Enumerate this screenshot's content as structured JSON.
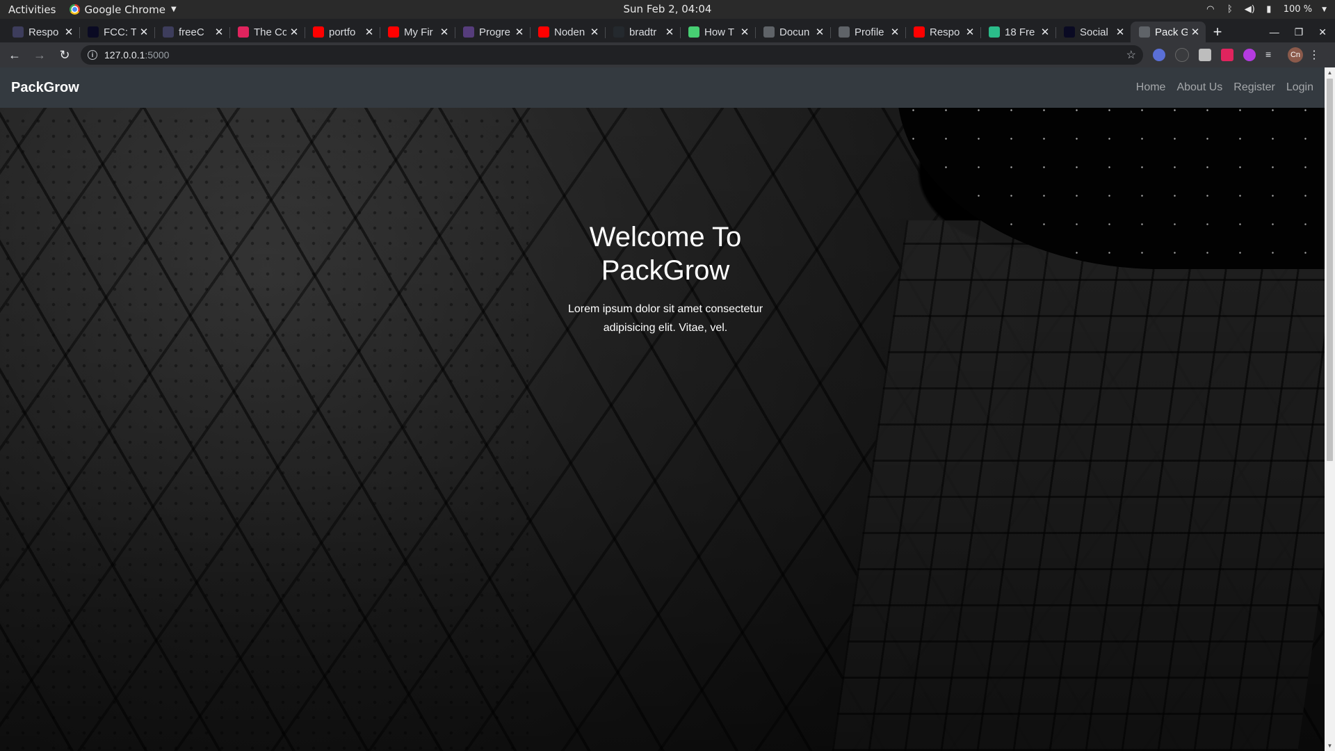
{
  "os": {
    "activities": "Activities",
    "app_name": "Google Chrome",
    "clock": "Sun Feb  2, 04:04",
    "battery": "100 %"
  },
  "tabs": [
    {
      "title": "Respo",
      "favicon": "dev-icon",
      "color": "#3d3d5c"
    },
    {
      "title": "FCC: T",
      "favicon": "freecodecamp-icon",
      "color": "#0a0a23"
    },
    {
      "title": "freeC",
      "favicon": "dev-icon",
      "color": "#3d3d5c"
    },
    {
      "title": "The Co",
      "favicon": "scrimba-icon",
      "color": "#e0245e"
    },
    {
      "title": "portfo",
      "favicon": "youtube-icon",
      "color": "#ff0000"
    },
    {
      "title": "My Fir",
      "favicon": "youtube-icon",
      "color": "#ff0000"
    },
    {
      "title": "Progre",
      "favicon": "bootstrap-icon",
      "color": "#563d7c"
    },
    {
      "title": "Noden",
      "favicon": "youtube-icon",
      "color": "#ff0000"
    },
    {
      "title": "bradtr",
      "favicon": "github-icon",
      "color": "#24292e"
    },
    {
      "title": "How T",
      "favicon": "codepen-icon",
      "color": "#47cf73"
    },
    {
      "title": "Docun",
      "favicon": "globe-icon",
      "color": "#5f6368"
    },
    {
      "title": "Profile",
      "favicon": "globe-icon",
      "color": "#5f6368"
    },
    {
      "title": "Respo",
      "favicon": "youtube-icon",
      "color": "#ff0000"
    },
    {
      "title": "18 Fre",
      "favicon": "circle-icon",
      "color": "#2bbc8a"
    },
    {
      "title": "Social",
      "favicon": "freecodecamp-icon",
      "color": "#0a0a23"
    },
    {
      "title": "Pack G",
      "favicon": "globe-icon",
      "color": "#5f6368",
      "active": true
    }
  ],
  "omnibox": {
    "host": "127.0.0.1",
    "port": ":5000"
  },
  "site": {
    "brand": "PackGrow",
    "nav": [
      "Home",
      "About Us",
      "Register",
      "Login"
    ],
    "hero": {
      "title": "Welcome To PackGrow",
      "subtitle": "Lorem ipsum dolor sit amet consectetur adipisicing elit. Vitae, vel."
    },
    "colors": {
      "navbar_bg": "#343a40",
      "nav_link": "rgba(255,255,255,.55)",
      "hero_text": "#ffffff"
    }
  }
}
